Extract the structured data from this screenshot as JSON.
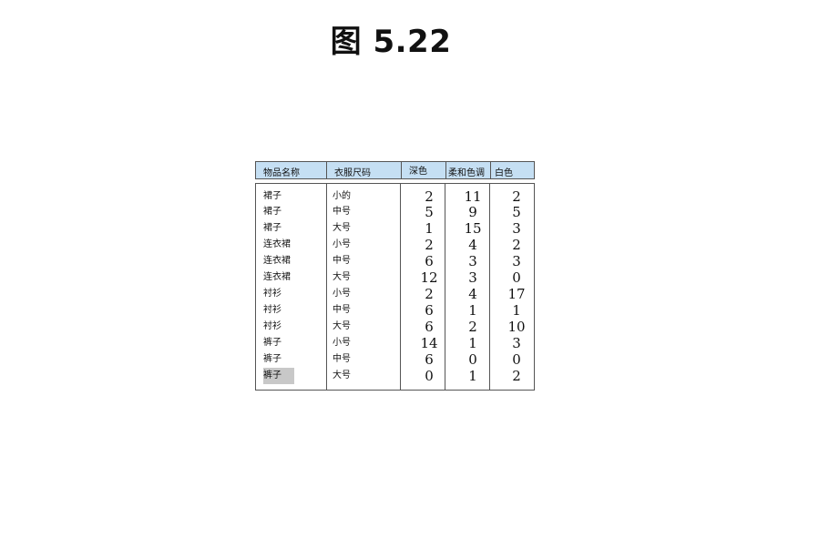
{
  "figure_title": "图 5.22",
  "table": {
    "headers": [
      "物品名称",
      "衣服尺码",
      "深色",
      "柔和色调",
      "白色"
    ],
    "rows": [
      {
        "item": "裙子",
        "size": "小的",
        "dark": "2",
        "pastel": "11",
        "white": "2"
      },
      {
        "item": "裙子",
        "size": "中号",
        "dark": "5",
        "pastel": "9",
        "white": "5"
      },
      {
        "item": "裙子",
        "size": "大号",
        "dark": "1",
        "pastel": "15",
        "white": "3"
      },
      {
        "item": "连衣裙",
        "size": "小号",
        "dark": "2",
        "pastel": "4",
        "white": "2"
      },
      {
        "item": "连衣裙",
        "size": "中号",
        "dark": "6",
        "pastel": "3",
        "white": "3"
      },
      {
        "item": "连衣裙",
        "size": "大号",
        "dark": "12",
        "pastel": "3",
        "white": "0"
      },
      {
        "item": "衬衫",
        "size": "小号",
        "dark": "2",
        "pastel": "4",
        "white": "17"
      },
      {
        "item": "衬衫",
        "size": "中号",
        "dark": "6",
        "pastel": "1",
        "white": "1"
      },
      {
        "item": "衬衫",
        "size": "大号",
        "dark": "6",
        "pastel": "2",
        "white": "10"
      },
      {
        "item": "裤子",
        "size": "小号",
        "dark": "14",
        "pastel": "1",
        "white": "3"
      },
      {
        "item": "裤子",
        "size": "中号",
        "dark": "6",
        "pastel": "0",
        "white": "0"
      },
      {
        "item": "裤子",
        "size": "大号",
        "dark": "0",
        "pastel": "1",
        "white": "2"
      }
    ],
    "highlight_color": "#c8c8c8",
    "header_color": "#c5dff3"
  }
}
